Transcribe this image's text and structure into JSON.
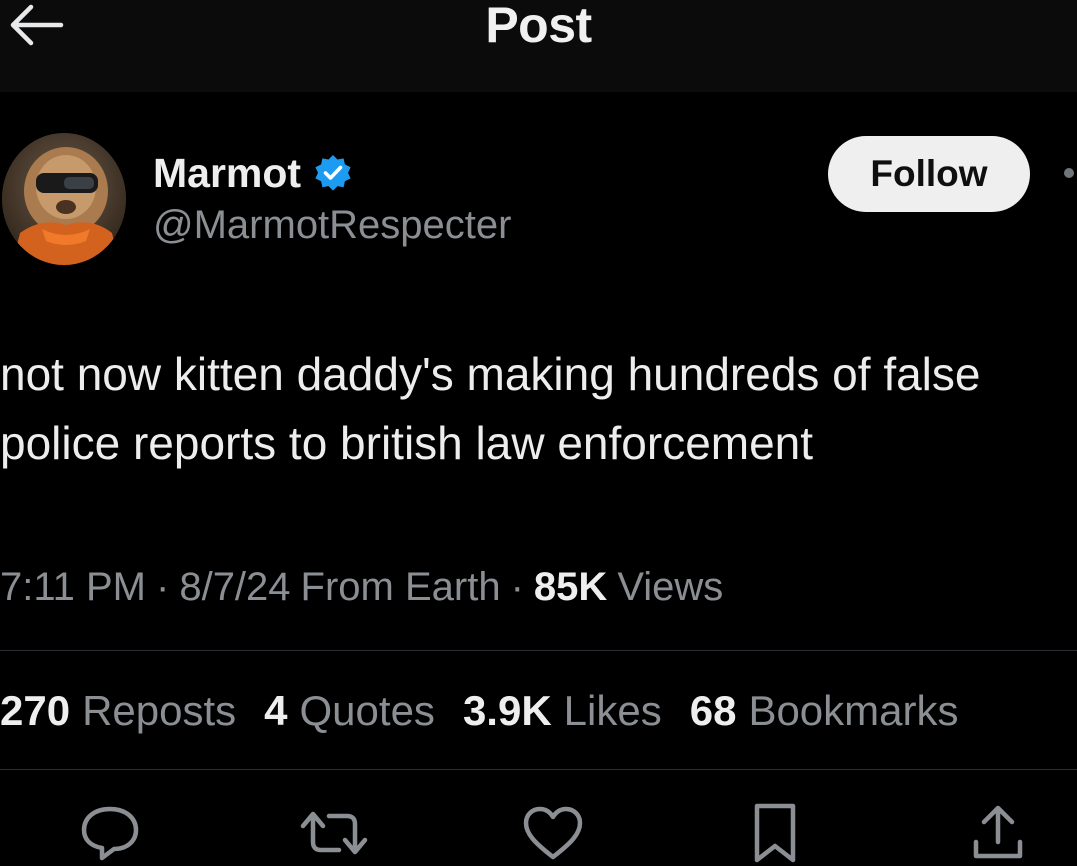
{
  "header": {
    "title": "Post",
    "back_icon": "arrow-left-icon"
  },
  "author": {
    "name": "Marmot",
    "handle": "@MarmotRespecter",
    "verified_icon": "verified-badge-icon",
    "follow_label": "Follow"
  },
  "tweet": {
    "text": "not now kitten daddy's making hundreds of false\npolice reports to british law enforcement"
  },
  "meta": {
    "time": "7:11 PM",
    "sep1": "·",
    "date": "8/7/24",
    "location": "From Earth",
    "sep2": "·",
    "views_count": "85K",
    "views_label": "Views"
  },
  "stats": [
    {
      "count": "270",
      "label": "Reposts"
    },
    {
      "count": "4",
      "label": "Quotes"
    },
    {
      "count": "3.9K",
      "label": "Likes"
    },
    {
      "count": "68",
      "label": "Bookmarks"
    }
  ],
  "actions": [
    "reply-icon",
    "repost-icon",
    "like-icon",
    "bookmark-icon",
    "share-icon"
  ],
  "colors": {
    "background": "#000000",
    "header_background": "#0b0b0b",
    "text_primary": "#e7e9ea",
    "text_secondary": "#8b8f94",
    "verified_blue": "#1d9bf0",
    "follow_button_bg": "#efefef"
  }
}
